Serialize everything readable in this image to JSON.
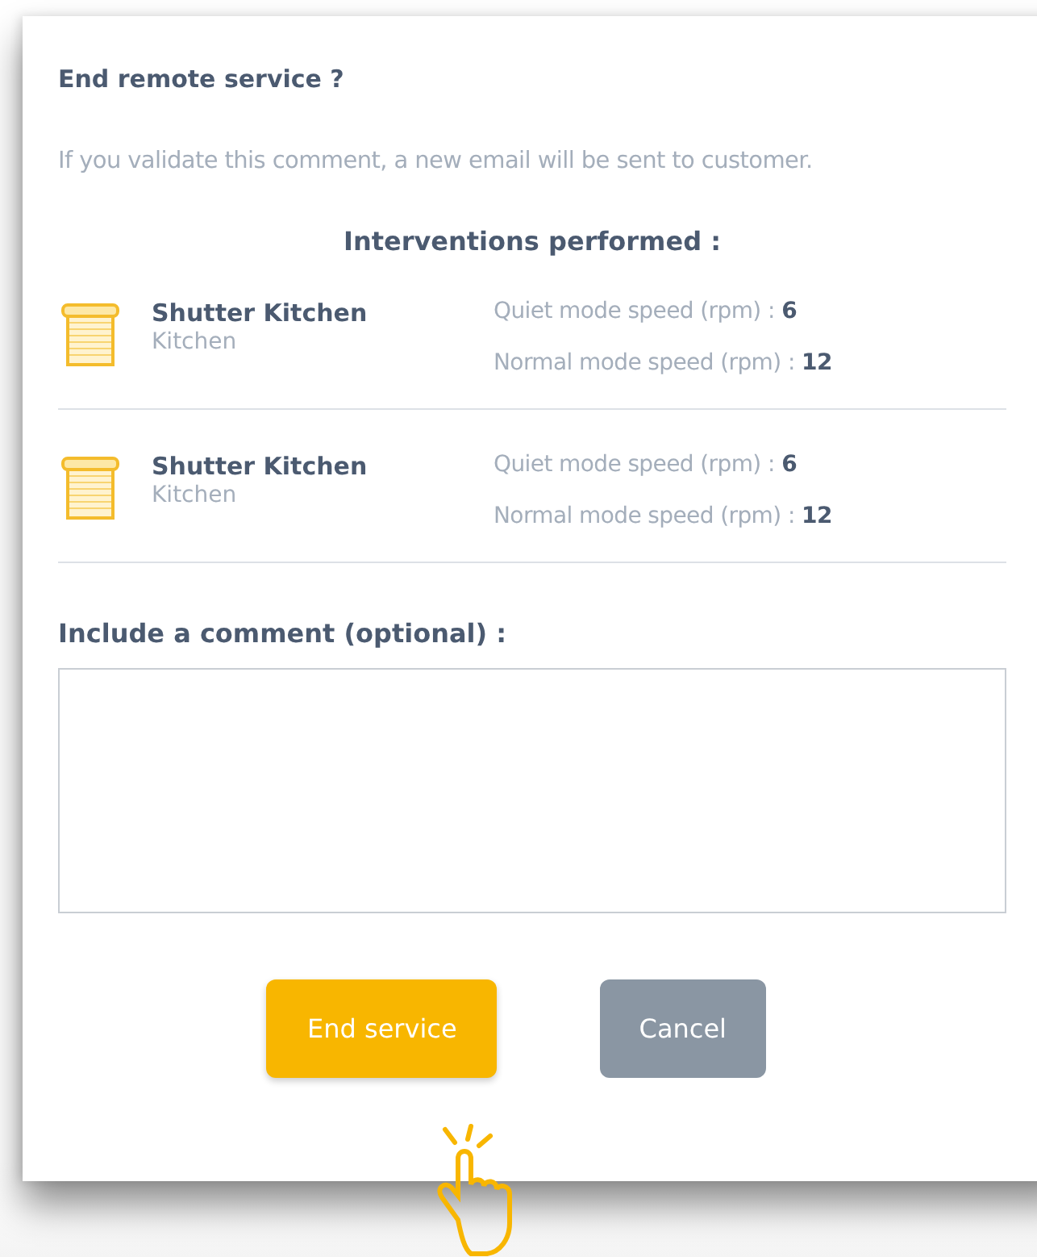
{
  "dialog": {
    "title": "End remote service ?",
    "message": "If you validate this comment, a new email will be sent to customer.",
    "section_title": "Interventions performed :",
    "interventions": [
      {
        "name": "Shutter Kitchen",
        "room": "Kitchen",
        "specs": [
          {
            "label": "Quiet mode speed (rpm) :",
            "value": "6"
          },
          {
            "label": "Normal mode speed (rpm) :",
            "value": "12"
          }
        ]
      },
      {
        "name": "Shutter Kitchen",
        "room": "Kitchen",
        "specs": [
          {
            "label": "Quiet mode speed (rpm) :",
            "value": "6"
          },
          {
            "label": "Normal mode speed (rpm) :",
            "value": "12"
          }
        ]
      }
    ],
    "comment_label": "Include a comment (optional) :",
    "buttons": [
      {
        "label": "End service",
        "kind": "primary"
      },
      {
        "label": "Cancel",
        "kind": "secondary"
      }
    ]
  }
}
